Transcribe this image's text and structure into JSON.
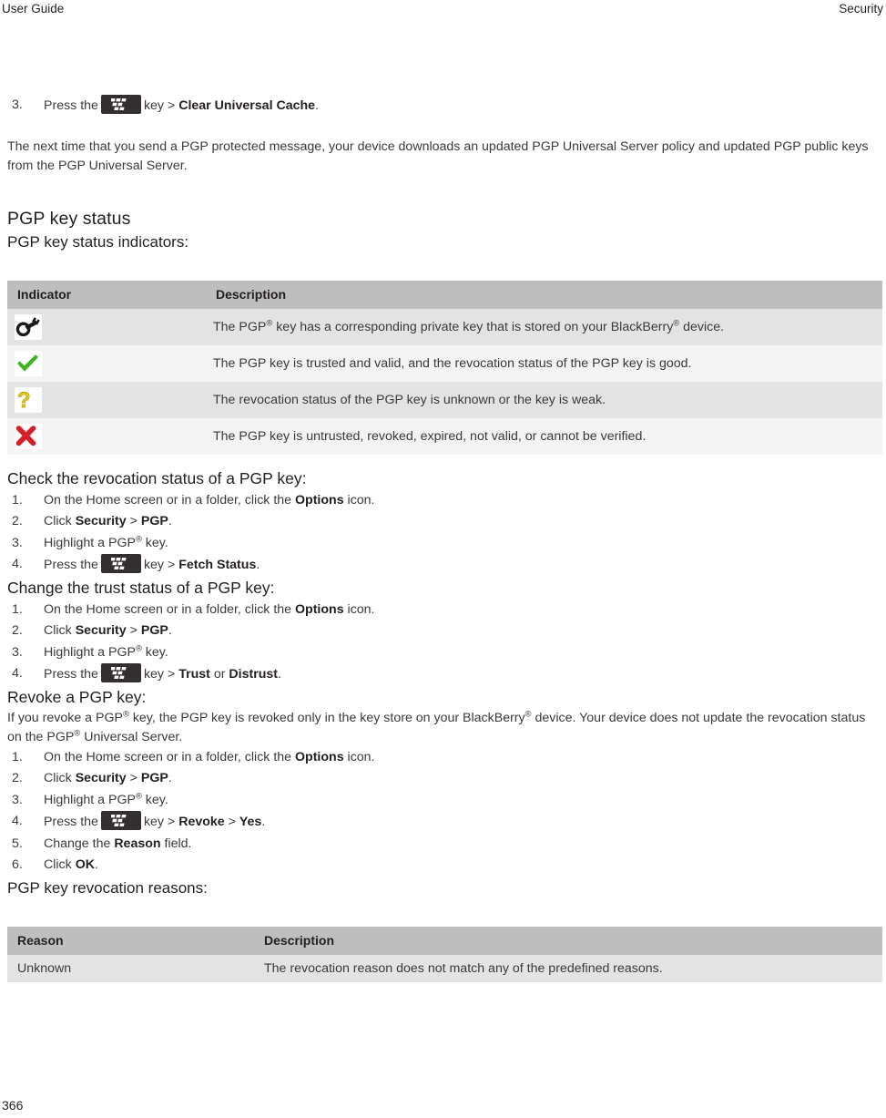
{
  "running_head": {
    "left": "User Guide",
    "right": "Security"
  },
  "folio": "366",
  "step_clear_cache": {
    "number": "3.",
    "text_before": "Press the",
    "key_word": "key >",
    "bold": "Clear Universal Cache",
    "period": "."
  },
  "intro_paragraph": "The next time that you send a PGP protected message, your device downloads an updated PGP Universal Server policy and updated PGP public keys from the PGP Universal Server.",
  "pgp_key_status": {
    "heading": "PGP key status",
    "subheading": "PGP key status indicators:"
  },
  "indicator_table": {
    "headers": [
      "Indicator",
      "Description"
    ],
    "rows": [
      {
        "icon": "key-icon",
        "description_parts": [
          "The PGP",
          "®",
          " key has a corresponding private key that is stored on your BlackBerry",
          "®",
          " device."
        ]
      },
      {
        "icon": "green-check-icon",
        "description_parts": [
          "The PGP key is trusted and valid, and the revocation status of the PGP key is good.",
          "",
          "",
          "",
          ""
        ]
      },
      {
        "icon": "yellow-question-icon",
        "description_parts": [
          "The revocation status of the PGP key is unknown or the key is weak.",
          "",
          "",
          "",
          ""
        ]
      },
      {
        "icon": "red-x-icon",
        "description_parts": [
          "The PGP key is untrusted, revoked, expired, not valid, or cannot be verified.",
          "",
          "",
          "",
          ""
        ]
      }
    ]
  },
  "check_revocation": {
    "heading": "Check the revocation status of a PGP key:",
    "steps": [
      {
        "num": "1.",
        "pre": "On the Home screen or in a folder, click the ",
        "bold1": "Options",
        "post": " icon."
      },
      {
        "num": "2.",
        "pre": "Click ",
        "bold1": "Security",
        "mid": " > ",
        "bold2": "PGP",
        "post": "."
      },
      {
        "num": "3.",
        "pre": "Highlight a PGP",
        "sup": "®",
        "post": " key."
      },
      {
        "num": "4.",
        "pre": "Press the",
        "key_word": "key >",
        "bold1": "Fetch Status",
        "post": "."
      }
    ]
  },
  "change_trust": {
    "heading": "Change the trust status of a PGP key:",
    "steps": [
      {
        "num": "1.",
        "pre": "On the Home screen or in a folder, click the ",
        "bold1": "Options",
        "post": " icon."
      },
      {
        "num": "2.",
        "pre": "Click ",
        "bold1": "Security",
        "mid": " > ",
        "bold2": "PGP",
        "post": "."
      },
      {
        "num": "3.",
        "pre": "Highlight a PGP",
        "sup": "®",
        "post": " key."
      },
      {
        "num": "4.",
        "pre": "Press the",
        "key_word": "key >",
        "bold1": "Trust",
        "mid": " or ",
        "bold2": "Distrust",
        "post": "."
      }
    ]
  },
  "revoke_key": {
    "heading": "Revoke a PGP key:",
    "paragraph_parts": [
      "If you revoke a PGP",
      "®",
      " key, the PGP key is revoked only in the key store on your BlackBerry",
      "®",
      " device. Your device does not update the revocation status on the PGP",
      "®",
      " Universal Server."
    ],
    "steps": [
      {
        "num": "1.",
        "pre": "On the Home screen or in a folder, click the ",
        "bold1": "Options",
        "post": " icon."
      },
      {
        "num": "2.",
        "pre": "Click ",
        "bold1": "Security",
        "mid": " > ",
        "bold2": "PGP",
        "post": "."
      },
      {
        "num": "3.",
        "pre": "Highlight a PGP",
        "sup": "®",
        "post": " key."
      },
      {
        "num": "4.",
        "pre": "Press the",
        "key_word": "key >",
        "bold1": "Revoke",
        "mid": " > ",
        "bold2": "Yes",
        "post": "."
      },
      {
        "num": "5.",
        "pre": "Change the ",
        "bold1": "Reason",
        "post": " field."
      },
      {
        "num": "6.",
        "pre": "Click ",
        "bold1": "OK",
        "post": "."
      }
    ]
  },
  "revocation_reasons": {
    "subheading": "PGP key revocation reasons:",
    "headers": [
      "Reason",
      "Description"
    ],
    "rows": [
      {
        "reason": "Unknown",
        "description": "The revocation reason does not match any of the predefined reasons."
      }
    ]
  },
  "colors": {
    "table_header_bg": "#bebebe",
    "row_odd_bg": "#e3e3e3",
    "row_even_bg": "#f3f3f3",
    "check_green": "#3cb521",
    "question_yellow": "#e8c51a",
    "x_red": "#d81f27",
    "key_black": "#1a1a1a",
    "bb_key_bg": "#332f30",
    "text": "#3a3a3a"
  }
}
